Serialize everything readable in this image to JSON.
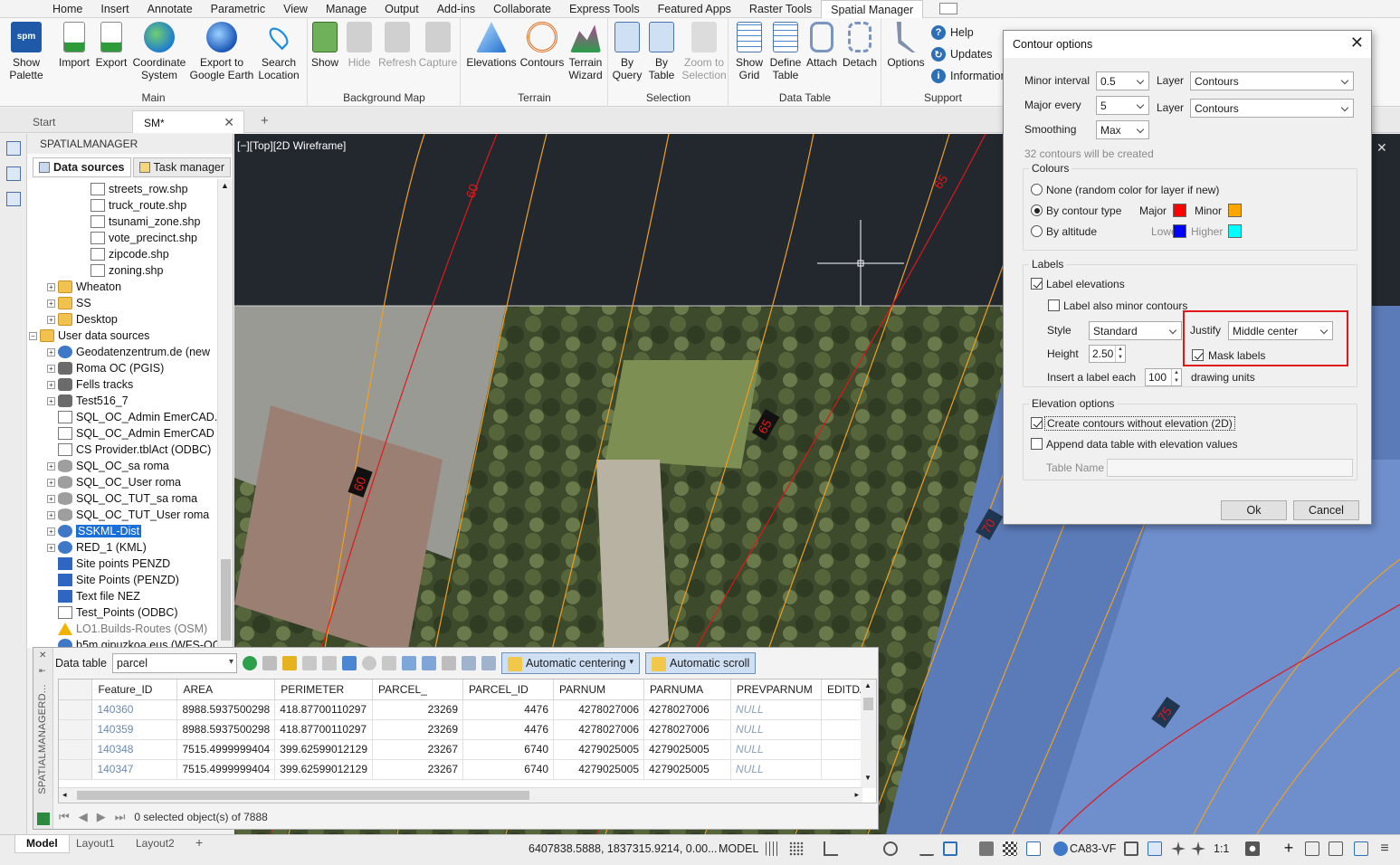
{
  "ribbon": {
    "tabs": [
      "Home",
      "Insert",
      "Annotate",
      "Parametric",
      "View",
      "Manage",
      "Output",
      "Add-ins",
      "Collaborate",
      "Express Tools",
      "Featured Apps",
      "Raster Tools",
      "Spatial Manager"
    ],
    "active_tab": "Spatial Manager",
    "main": {
      "title": "Main",
      "show_palette": "Show\nPalette",
      "import": "Import",
      "export": "Export",
      "coord_system": "Coordinate\nSystem",
      "export_ge": "Export to\nGoogle Earth",
      "search_location": "Search\nLocation"
    },
    "bgmap": {
      "title": "Background Map",
      "show": "Show",
      "hide": "Hide",
      "refresh": "Refresh",
      "capture": "Capture"
    },
    "terrain": {
      "title": "Terrain",
      "elevations": "Elevations",
      "contours": "Contours",
      "wizard": "Terrain\nWizard"
    },
    "selection": {
      "title": "Selection",
      "by_query": "By\nQuery",
      "by_table": "By\nTable",
      "zoom_sel": "Zoom to\nSelection"
    },
    "datatable": {
      "title": "Data Table",
      "show_grid": "Show\nGrid",
      "define_table": "Define\nTable",
      "attach": "Attach",
      "detach": "Detach"
    },
    "support": {
      "title": "Support",
      "options": "Options",
      "help": "Help",
      "updates": "Updates",
      "information": "Information"
    }
  },
  "doc_tabs": {
    "start": "Start",
    "active": "SM*",
    "add": "+"
  },
  "palette": {
    "title": "SPATIALMANAGER",
    "tab_sources": "Data sources",
    "tab_tasks": "Task manager",
    "tree": [
      {
        "label": "streets_row.shp",
        "icon": "file"
      },
      {
        "label": "truck_route.shp",
        "icon": "file"
      },
      {
        "label": "tsunami_zone.shp",
        "icon": "file"
      },
      {
        "label": "vote_precinct.shp",
        "icon": "file"
      },
      {
        "label": "zipcode.shp",
        "icon": "file"
      },
      {
        "label": "zoning.shp",
        "icon": "file"
      },
      {
        "label": "Wheaton",
        "icon": "folder"
      },
      {
        "label": "SS",
        "icon": "folder"
      },
      {
        "label": "Desktop",
        "icon": "folder"
      },
      {
        "label": "User data sources",
        "icon": "folder"
      },
      {
        "label": "Geodatenzentrum.de (new",
        "icon": "globe"
      },
      {
        "label": "Roma OC (PGIS)",
        "icon": "cog"
      },
      {
        "label": "Fells tracks",
        "icon": "cog"
      },
      {
        "label": "Test516_7",
        "icon": "cog"
      },
      {
        "label": "SQL_OC_Admin EmerCAD.",
        "icon": "file"
      },
      {
        "label": "SQL_OC_Admin EmerCAD I",
        "icon": "file"
      },
      {
        "label": "CS Provider.tblAct (ODBC)",
        "icon": "file"
      },
      {
        "label": "SQL_OC_sa roma",
        "icon": "db"
      },
      {
        "label": "SQL_OC_User roma",
        "icon": "db"
      },
      {
        "label": "SQL_OC_TUT_sa roma",
        "icon": "db"
      },
      {
        "label": "SQL_OC_TUT_User roma",
        "icon": "db"
      },
      {
        "label": "SSKML-Dist",
        "icon": "globe"
      },
      {
        "label": "RED_1 (KML)",
        "icon": "globe"
      },
      {
        "label": "Site points PENZD",
        "icon": "grid"
      },
      {
        "label": "Site Points (PENZD)",
        "icon": "grid"
      },
      {
        "label": "Text file NEZ",
        "icon": "grid"
      },
      {
        "label": "Test_Points (ODBC)",
        "icon": "file"
      },
      {
        "label": "LO1.Builds-Routes (OSM)",
        "icon": "warn"
      },
      {
        "label": "b5m.gipuzkoa.eus (WFS-OG",
        "icon": "globe"
      }
    ]
  },
  "viewport": {
    "label": "[−][Top][2D Wireframe]",
    "contour_labels": [
      "60",
      "65",
      "60",
      "65",
      "70",
      "75"
    ]
  },
  "data_table": {
    "side_label": "SPATIALMANAGERD...",
    "label": "Data table",
    "table_name": "parcel",
    "auto_centering": "Automatic centering",
    "auto_scroll": "Automatic scroll",
    "columns": [
      "Feature_ID",
      "AREA",
      "PERIMETER",
      "PARCEL_",
      "PARCEL_ID",
      "PARNUM",
      "PARNUMA",
      "PREVPARNUM",
      "EDITDA"
    ],
    "rows": [
      [
        "140360",
        "8988.5937500298",
        "418.87700110297",
        "23269",
        "4476",
        "4278027006",
        "4278027006",
        "NULL",
        ""
      ],
      [
        "140359",
        "8988.5937500298",
        "418.87700110297",
        "23269",
        "4476",
        "4278027006",
        "4278027006",
        "NULL",
        ""
      ],
      [
        "140348",
        "7515.4999999404",
        "399.62599012129",
        "23267",
        "6740",
        "4279025005",
        "4279025005",
        "NULL",
        ""
      ],
      [
        "140347",
        "7515.4999999404",
        "399.62599012129",
        "23267",
        "6740",
        "4279025005",
        "4279025005",
        "NULL",
        ""
      ]
    ],
    "status": "0 selected object(s) of 7888"
  },
  "statusbar": {
    "layout_tabs": [
      "Model",
      "Layout1",
      "Layout2"
    ],
    "coords": "6407838.5888, 1837315.9214, 0.00...",
    "model": "MODEL",
    "crs": "CA83-VF",
    "scale": "1:1"
  },
  "dialog": {
    "title": "Contour options",
    "minor_interval_label": "Minor interval",
    "minor_interval": "0.5",
    "layer_label": "Layer",
    "layer1": "Contours",
    "major_every_label": "Major every",
    "major_every": "5",
    "layer2": "Contours",
    "smoothing_label": "Smoothing",
    "smoothing": "Max",
    "info": "32 contours will be created",
    "colours_legend": "Colours",
    "radio_none": "None (random color for layer if new)",
    "radio_type": "By contour type",
    "radio_alt": "By altitude",
    "major_label": "Major",
    "minor_label": "Minor",
    "lower_label": "Lower",
    "higher_label": "Higher",
    "colors": {
      "major": "#ff0000",
      "minor": "#ffa500",
      "lower": "#0000ff",
      "higher": "#00ffff"
    },
    "labels_legend": "Labels",
    "label_elevations": "Label elevations",
    "label_minor": "Label also minor contours",
    "style_label": "Style",
    "style": "Standard",
    "justify_label": "Justify",
    "justify": "Middle center",
    "height_label": "Height",
    "height": "2.50",
    "mask_labels": "Mask labels",
    "each_label": "Insert a label each",
    "each_value": "100",
    "units": "drawing units",
    "elev_legend": "Elevation options",
    "no_elev": "Create contours without elevation (2D)",
    "append_table": "Append data table with elevation values",
    "table_name_label": "Table Name",
    "ok": "Ok",
    "cancel": "Cancel"
  }
}
